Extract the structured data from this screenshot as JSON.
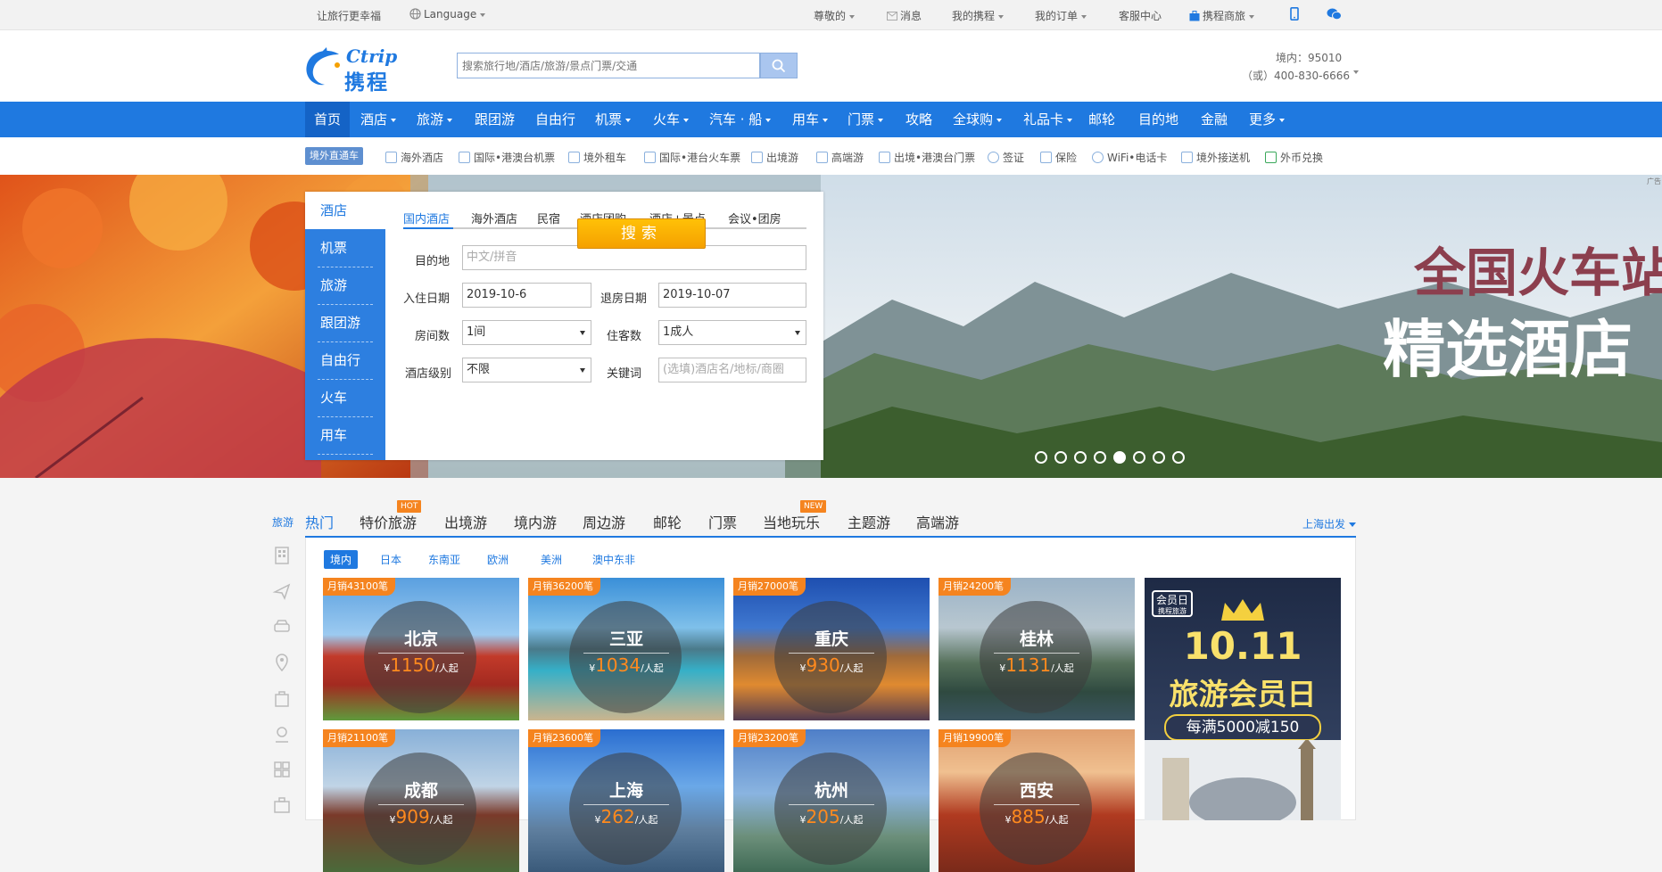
{
  "topbar": {
    "slogan": "让旅行更幸福",
    "language": "Language",
    "greeting": "尊敬的",
    "messages": "消息",
    "my_trips": "我的携程",
    "my_orders": "我的订单",
    "service": "客服中心",
    "merchant": "携程商旅"
  },
  "header": {
    "logo_text": "携程",
    "logo_en": "Ctrip",
    "search_placeholder": "搜索旅行地/酒店/旅游/景点门票/交通",
    "hotline_domestic": "境内：95010",
    "hotline_alt": "（或）400-830-6666"
  },
  "mainnav": [
    {
      "label": "首页",
      "dropdown": false
    },
    {
      "label": "酒店",
      "dropdown": true
    },
    {
      "label": "旅游",
      "dropdown": true
    },
    {
      "label": "跟团游",
      "dropdown": false
    },
    {
      "label": "自由行",
      "dropdown": false
    },
    {
      "label": "机票",
      "dropdown": true
    },
    {
      "label": "火车",
      "dropdown": true
    },
    {
      "label": "汽车 · 船",
      "dropdown": true
    },
    {
      "label": "用车",
      "dropdown": true
    },
    {
      "label": "门票",
      "dropdown": true
    },
    {
      "label": "攻略",
      "dropdown": false
    },
    {
      "label": "全球购",
      "dropdown": true
    },
    {
      "label": "礼品卡",
      "dropdown": true
    },
    {
      "label": "邮轮",
      "dropdown": false
    },
    {
      "label": "目的地",
      "dropdown": false
    },
    {
      "label": "金融",
      "dropdown": false
    },
    {
      "label": "更多",
      "dropdown": true
    }
  ],
  "subnav": {
    "badge": "境外直通车",
    "items": [
      "海外酒店",
      "国际•港澳台机票",
      "境外租车",
      "国际•港台火车票",
      "出境游",
      "高端游",
      "出境•港澳台门票",
      "签证",
      "保险",
      "WiFi•电话卡",
      "境外接送机",
      "外币兑换"
    ]
  },
  "banner": {
    "line1": "全国火车站",
    "line2": "精选酒店",
    "ad_tag": "广告",
    "active_slide": 5,
    "slide_count": 8
  },
  "booking": {
    "side_tabs": [
      "酒店",
      "机票",
      "旅游",
      "跟团游",
      "自由行",
      "火车",
      "用车"
    ],
    "form_tabs": [
      "国内酒店",
      "海外酒店",
      "民宿",
      "酒店团购",
      "酒店+景点",
      "会议•团房"
    ],
    "dest_label": "目的地",
    "dest_placeholder": "中文/拼音",
    "checkin_label": "入住日期",
    "checkin_value": "2019-10-6",
    "checkout_label": "退房日期",
    "checkout_value": "2019-10-07",
    "rooms_label": "房间数",
    "rooms_value": "1间",
    "guests_label": "住客数",
    "guests_value": "1成人",
    "level_label": "酒店级别",
    "level_value": "不限",
    "keyword_label": "关键词",
    "keyword_placeholder": "(选填)酒店名/地标/商圈",
    "search_button": "搜索"
  },
  "travel": {
    "side_label": "旅游",
    "tabs": [
      {
        "label": "热门",
        "badge": ""
      },
      {
        "label": "特价旅游",
        "badge": "HOT"
      },
      {
        "label": "出境游",
        "badge": ""
      },
      {
        "label": "境内游",
        "badge": ""
      },
      {
        "label": "周边游",
        "badge": ""
      },
      {
        "label": "邮轮",
        "badge": ""
      },
      {
        "label": "门票",
        "badge": ""
      },
      {
        "label": "当地玩乐",
        "badge": "NEW"
      },
      {
        "label": "主题游",
        "badge": ""
      },
      {
        "label": "高端游",
        "badge": ""
      }
    ],
    "depart": "上海出发",
    "regions": [
      "境内",
      "日本",
      "东南亚",
      "欧洲",
      "美洲",
      "澳中东非"
    ],
    "cards": [
      {
        "city": "北京",
        "sales": "月销43100笔",
        "price": "1150",
        "unit": "/人起",
        "currency": "¥"
      },
      {
        "city": "三亚",
        "sales": "月销36200笔",
        "price": "1034",
        "unit": "/人起",
        "currency": "¥"
      },
      {
        "city": "重庆",
        "sales": "月销27000笔",
        "price": "930",
        "unit": "/人起",
        "currency": "¥"
      },
      {
        "city": "桂林",
        "sales": "月销24200笔",
        "price": "1131",
        "unit": "/人起",
        "currency": "¥"
      },
      {
        "city": "成都",
        "sales": "月销21100笔",
        "price": "909",
        "unit": "/人起",
        "currency": "¥"
      },
      {
        "city": "上海",
        "sales": "月销23600笔",
        "price": "262",
        "unit": "/人起",
        "currency": "¥"
      },
      {
        "city": "杭州",
        "sales": "月销23200笔",
        "price": "205",
        "unit": "/人起",
        "currency": "¥"
      },
      {
        "city": "西安",
        "sales": "月销19900笔",
        "price": "885",
        "unit": "/人起",
        "currency": "¥"
      }
    ],
    "promo": {
      "badge": "会员日",
      "brand": "携程旅游",
      "date": "10.11",
      "title": "旅游会员日",
      "offer": "每满5000减150"
    }
  },
  "colors": {
    "brand_blue": "#1f79e0",
    "orange": "#f5841f",
    "button_yellow": "#f5a000"
  }
}
